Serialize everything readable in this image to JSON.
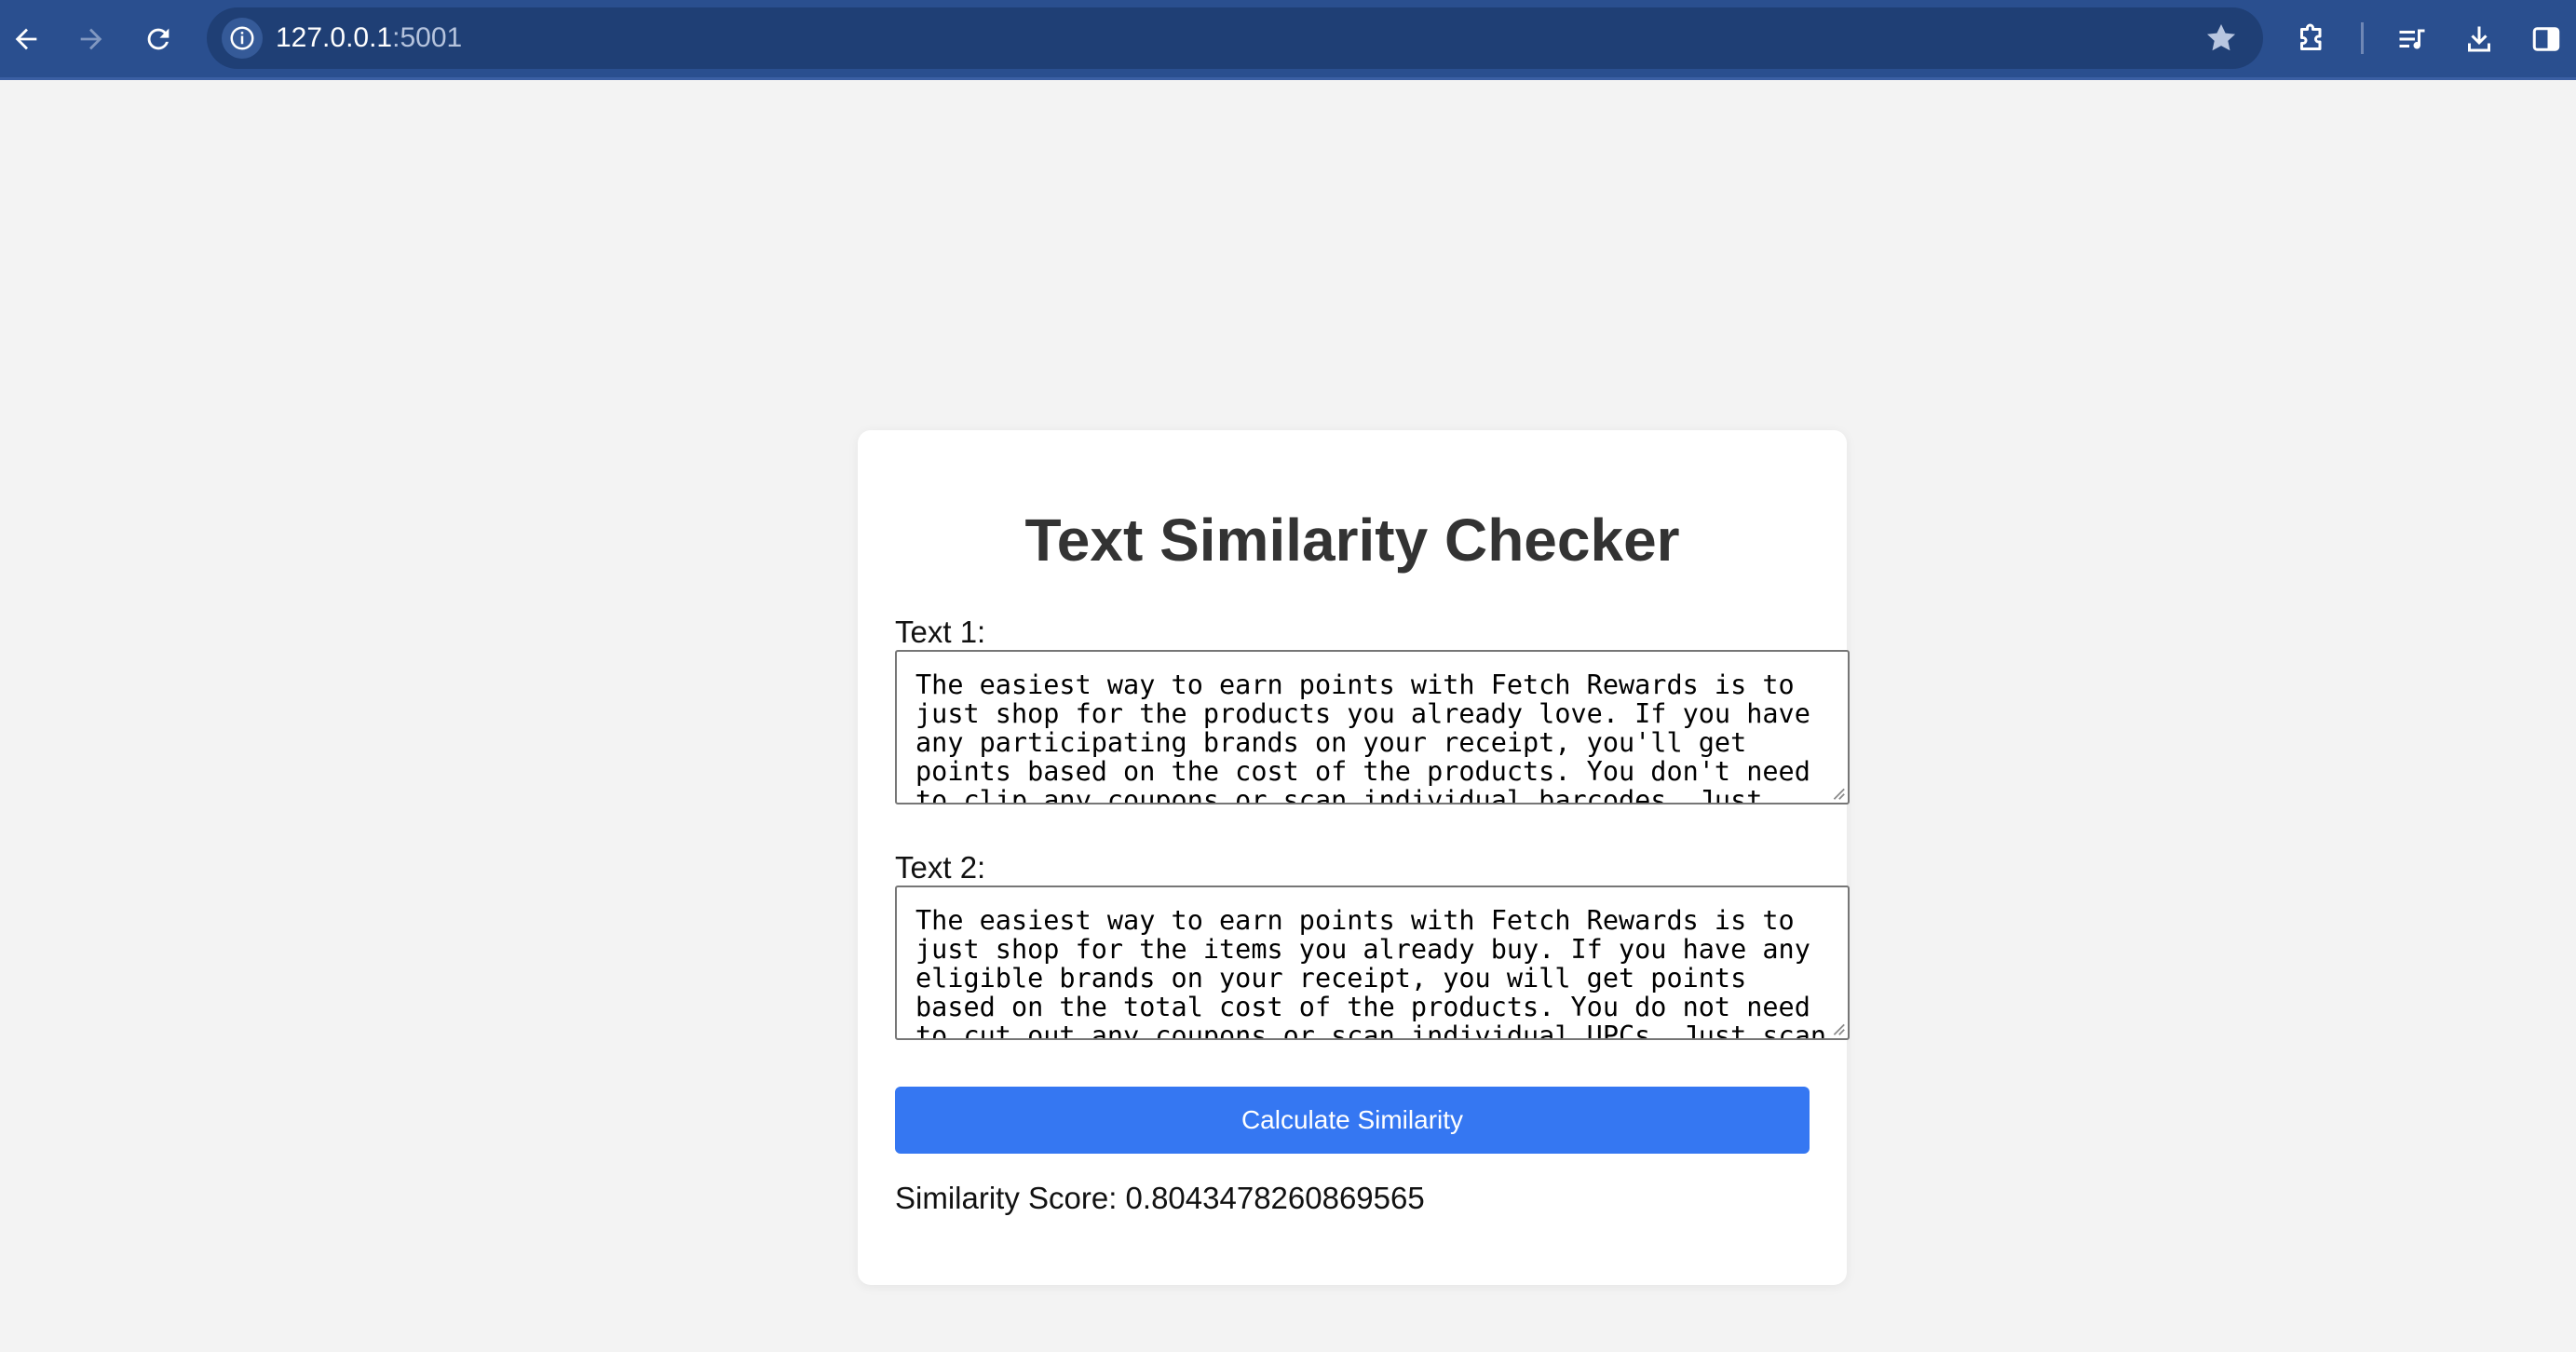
{
  "browser": {
    "url_host": "127.0.0.1",
    "url_port": ":5001",
    "icons": [
      "back-icon",
      "forward-icon",
      "reload-icon",
      "site-info-icon",
      "bookmark-star-icon",
      "extensions-icon",
      "media-queue-icon",
      "download-icon",
      "side-panel-icon"
    ]
  },
  "page": {
    "title": "Text Similarity Checker",
    "text1_label": "Text 1:",
    "text1_value": "The easiest way to earn points with Fetch Rewards is to just shop for the products you already love. If you have any participating brands on your receipt, you'll get points based on the cost of the products. You don't need to clip any coupons or scan individual barcodes. Just scan each grocery",
    "text2_label": "Text 2:",
    "text2_value": "The easiest way to earn points with Fetch Rewards is to just shop for the items you already buy. If you have any eligible brands on your receipt, you will get points based on the total cost of the products. You do not need to cut out any coupons or scan individual UPCs. Just scan your receipt after",
    "button_label": "Calculate Similarity",
    "score_text": "Similarity Score: 0.8043478260869565"
  },
  "colors": {
    "browser_bar": "#2a4f8f",
    "button": "#3577f2",
    "background": "#f3f3f3",
    "card": "#ffffff"
  }
}
